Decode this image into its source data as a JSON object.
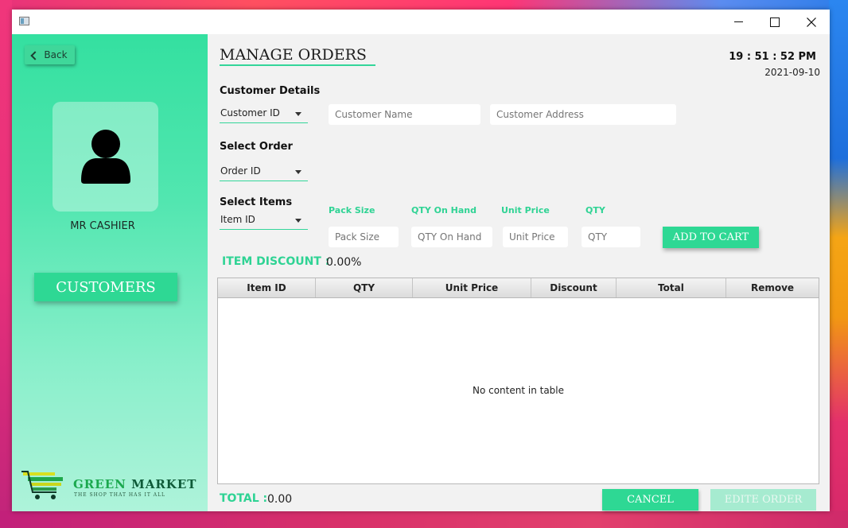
{
  "window": {
    "title": "",
    "controls": [
      "minimize",
      "maximize",
      "close"
    ]
  },
  "sidebar": {
    "back_label": "Back",
    "user_name": "MR CASHIER",
    "customers_label": "CUSTOMERS",
    "logo": {
      "name_part1": "GREEN",
      "name_part2": "MARKET",
      "tagline": "THE SHOP THAT HAS IT ALL"
    }
  },
  "header": {
    "title": "MANAGE ORDERS",
    "time": "19 : 51 : 52 PM",
    "date": "2021-09-10"
  },
  "customer": {
    "section_label": "Customer Details",
    "id_combo": "Customer ID",
    "name_placeholder": "Customer Name",
    "address_placeholder": "Customer Address"
  },
  "order": {
    "section_label": "Select Order",
    "id_combo": "Order ID"
  },
  "items": {
    "section_label": "Select Items",
    "id_combo": "Item ID",
    "pack_size_label": "Pack Size",
    "pack_size_placeholder": "Pack Size",
    "qty_on_hand_label": "QTY On Hand",
    "qty_on_hand_placeholder": "QTY On Hand",
    "unit_price_label": "Unit Price",
    "unit_price_placeholder": "Unit Price",
    "qty_label": "QTY",
    "qty_placeholder": "QTY",
    "add_to_cart_label": "ADD TO CART"
  },
  "discount": {
    "label": "ITEM DISCOUNT :",
    "value": "0.00%"
  },
  "table": {
    "columns": [
      "Item ID",
      "QTY",
      "Unit Price",
      "Discount",
      "Total",
      "Remove"
    ],
    "rows": [],
    "empty_message": "No content in table"
  },
  "footer": {
    "total_label": "TOTAL :",
    "total_value": "0.00",
    "cancel_label": "CANCEL",
    "edit_label": "EDITE ORDER"
  },
  "colors": {
    "accent": "#2ed894",
    "label_green": "#2fd394",
    "sidebar_top": "#34e0a0",
    "sidebar_bottom": "#aef3da"
  },
  "icons": [
    "app-window-icon",
    "minimize-icon",
    "maximize-icon",
    "close-icon",
    "chevron-left-icon",
    "user-avatar-icon",
    "dropdown-arrow-icon",
    "shopping-cart-icon"
  ]
}
